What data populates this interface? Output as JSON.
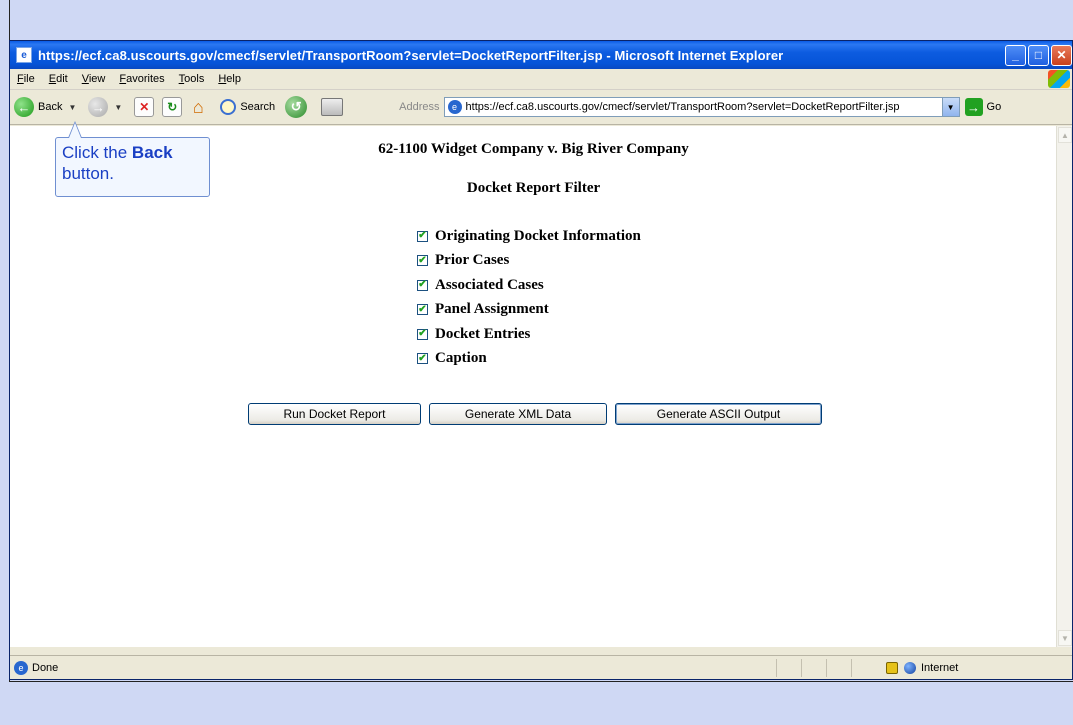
{
  "window": {
    "title": "https://ecf.ca8.uscourts.gov/cmecf/servlet/TransportRoom?servlet=DocketReportFilter.jsp - Microsoft Internet Explorer"
  },
  "menu": [
    "File",
    "Edit",
    "View",
    "Favorites",
    "Tools",
    "Help"
  ],
  "toolbar": {
    "back_label": "Back",
    "search_label": "Search",
    "address_label": "Address",
    "address_url": "https://ecf.ca8.uscourts.gov/cmecf/servlet/TransportRoom?servlet=DocketReportFilter.jsp",
    "go_label": "Go"
  },
  "callout": {
    "prefix": "Click the ",
    "emphasis": "Back",
    "suffix": "button."
  },
  "page": {
    "case_title": "62-1100 Widget Company v. Big River Company",
    "filter_title": "Docket Report Filter",
    "options": [
      {
        "label": "Originating Docket Information",
        "checked": true
      },
      {
        "label": "Prior Cases",
        "checked": true
      },
      {
        "label": "Associated Cases",
        "checked": true
      },
      {
        "label": "Panel Assignment",
        "checked": true
      },
      {
        "label": "Docket Entries",
        "checked": true
      },
      {
        "label": "Caption",
        "checked": true
      }
    ],
    "buttons": {
      "run": "Run Docket Report",
      "xml": "Generate XML Data",
      "ascii": "Generate ASCII Output"
    }
  },
  "status": {
    "text": "Done",
    "zone": "Internet"
  }
}
